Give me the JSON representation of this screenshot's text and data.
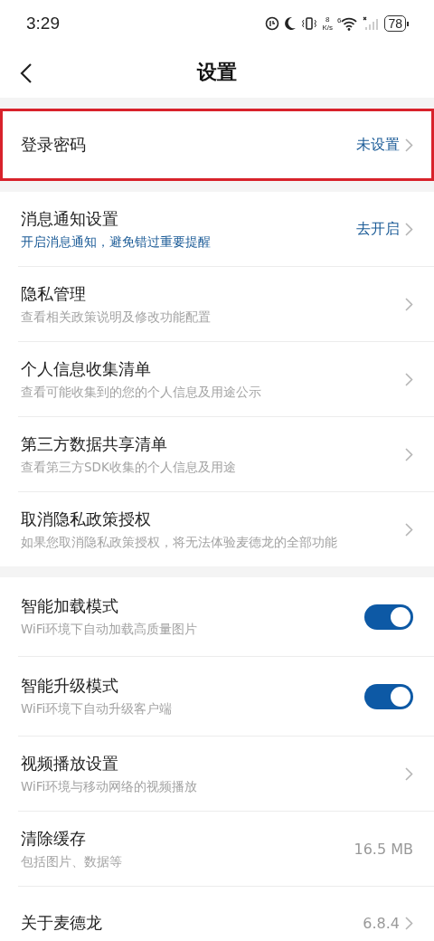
{
  "status_bar": {
    "time": "3:29",
    "net_speed": "8",
    "net_unit": "K/s",
    "wifi_badge": "6",
    "battery": "78"
  },
  "header": {
    "title": "设置"
  },
  "sections": [
    {
      "rows": [
        {
          "kind": "nav",
          "title": "登录密码",
          "value": "未设置",
          "value_accent": true,
          "highlighted": true
        }
      ]
    },
    {
      "rows": [
        {
          "kind": "nav",
          "title": "消息通知设置",
          "subtitle": "开启消息通知，避免错过重要提醒",
          "subtitle_accent": true,
          "value": "去开启",
          "value_accent": true,
          "highlighted": false
        },
        {
          "kind": "nav",
          "title": "隐私管理",
          "subtitle": "查看相关政策说明及修改功能配置",
          "subtitle_accent": false,
          "highlighted": false
        },
        {
          "kind": "nav",
          "title": "个人信息收集清单",
          "subtitle": "查看可能收集到的您的个人信息及用途公示",
          "subtitle_accent": false,
          "highlighted": false
        },
        {
          "kind": "nav",
          "title": "第三方数据共享清单",
          "subtitle": "查看第三方SDK收集的个人信息及用途",
          "subtitle_accent": false,
          "highlighted": false
        },
        {
          "kind": "nav",
          "title": "取消隐私政策授权",
          "subtitle": "如果您取消隐私政策授权，将无法体验麦德龙的全部功能",
          "subtitle_accent": false,
          "highlighted": false
        }
      ]
    },
    {
      "rows": [
        {
          "kind": "toggle",
          "title": "智能加载模式",
          "subtitle": "WiFi环境下自动加载高质量图片",
          "subtitle_accent": false,
          "on": true,
          "highlighted": false
        },
        {
          "kind": "toggle",
          "title": "智能升级模式",
          "subtitle": "WiFi环境下自动升级客户端",
          "subtitle_accent": false,
          "on": true,
          "highlighted": false
        },
        {
          "kind": "nav",
          "title": "视频播放设置",
          "subtitle": "WiFi环境与移动网络的视频播放",
          "subtitle_accent": false,
          "highlighted": false
        },
        {
          "kind": "info",
          "title": "清除缓存",
          "subtitle": "包括图片、数据等",
          "subtitle_accent": false,
          "value": "16.5 MB",
          "value_accent": false,
          "highlighted": false
        },
        {
          "kind": "nav",
          "title": "关于麦德龙",
          "value": "6.8.4",
          "value_accent": false,
          "highlighted": false
        }
      ]
    }
  ]
}
